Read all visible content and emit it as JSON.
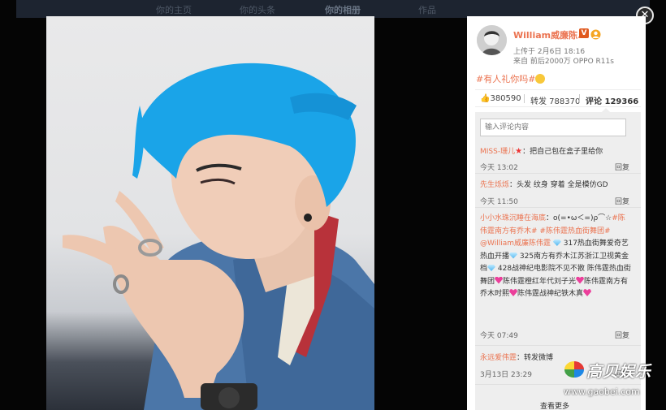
{
  "background_nav": {
    "tabs": [
      "你的主页",
      "你的头条",
      "你的相册",
      "作品"
    ]
  },
  "close_label": "✕",
  "post": {
    "username": "William威廉陈...",
    "verified_badge": "V",
    "uploaded_at": "上传于 2月6日 18:16",
    "source": "来自 前后2000万 OPPO R11s",
    "text": "#有人礼你吗#"
  },
  "stats": {
    "likes": "380590",
    "reposts_label": "转发 788370",
    "comments_label": "评论 129366"
  },
  "comment_input": {
    "placeholder": "输入评论内容"
  },
  "comments": [
    {
      "name": "MISS-珊儿",
      "text": "：把自己包在盒子里给你",
      "time": "今天 13:02",
      "reply": "回复"
    },
    {
      "name": "先生烁烁",
      "text": "：头发  纹身  穿着  全是模仿GD",
      "time": "今天 11:50",
      "reply": "回复"
    },
    {
      "name": "小小水珠沉睡在海底",
      "text_parts": [
        "：o(=•ω＜=)ρ⌒☆",
        "#陈伟霆南方有乔木#",
        " ",
        "#陈伟霆热血街舞团#",
        " ",
        "@William威廉陈伟霆",
        " 317热血街舞爱奇艺热血开播",
        " 325南方有乔木江苏浙江卫视黄金档",
        " 428战神纪电影院不见不散 陈伟霆热血街舞团",
        "陈伟霆橙红年代刘子光",
        "陈伟霆南方有乔木时熙",
        "陈伟霆战神纪铁木真"
      ],
      "time": "今天 07:49",
      "reply": "回复"
    },
    {
      "name": "永远爱伟霆",
      "text": "：转发微博",
      "time": "3月13日 23:29",
      "reply": "回复"
    }
  ],
  "more_label": "查看更多",
  "watermark": {
    "brand": "高贝娱乐",
    "url": "www.gaobei.com"
  },
  "colors": {
    "accent": "#eb7350",
    "panel_bg": "#ffffff",
    "comment_bg": "#eeeeee"
  }
}
